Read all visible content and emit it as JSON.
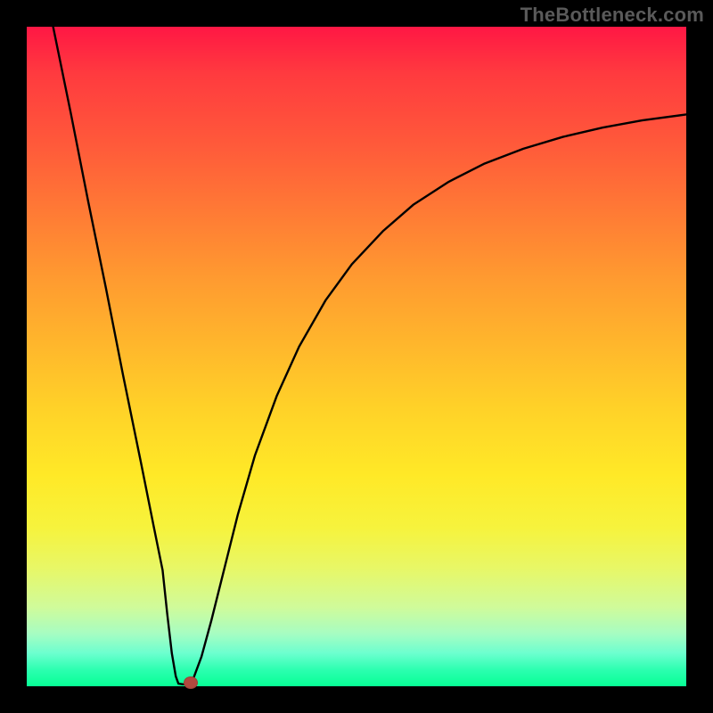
{
  "attribution": "TheBottleneck.com",
  "chart_data": {
    "type": "line",
    "title": "",
    "xlabel": "",
    "ylabel": "",
    "xlim": [
      0,
      100
    ],
    "ylim": [
      0,
      100
    ],
    "grid": false,
    "legend": false,
    "background": "rainbow-gradient-red-to-green-vertical",
    "curve_points": [
      {
        "x": 4.0,
        "y": 100.0
      },
      {
        "x": 6.7,
        "y": 86.8
      },
      {
        "x": 9.3,
        "y": 73.6
      },
      {
        "x": 12.0,
        "y": 60.4
      },
      {
        "x": 14.6,
        "y": 47.2
      },
      {
        "x": 17.3,
        "y": 34.0
      },
      {
        "x": 19.3,
        "y": 24.0
      },
      {
        "x": 20.6,
        "y": 17.6
      },
      {
        "x": 21.3,
        "y": 11.0
      },
      {
        "x": 22.0,
        "y": 5.0
      },
      {
        "x": 22.6,
        "y": 1.5
      },
      {
        "x": 23.0,
        "y": 0.4
      },
      {
        "x": 23.7,
        "y": 0.3
      },
      {
        "x": 24.3,
        "y": 0.3
      },
      {
        "x": 25.2,
        "y": 1.0
      },
      {
        "x": 26.5,
        "y": 4.5
      },
      {
        "x": 28.0,
        "y": 10.0
      },
      {
        "x": 30.0,
        "y": 18.0
      },
      {
        "x": 32.0,
        "y": 26.0
      },
      {
        "x": 34.6,
        "y": 35.0
      },
      {
        "x": 37.9,
        "y": 44.0
      },
      {
        "x": 41.3,
        "y": 51.5
      },
      {
        "x": 45.3,
        "y": 58.5
      },
      {
        "x": 49.3,
        "y": 64.0
      },
      {
        "x": 54.0,
        "y": 69.0
      },
      {
        "x": 58.6,
        "y": 73.0
      },
      {
        "x": 64.0,
        "y": 76.5
      },
      {
        "x": 69.3,
        "y": 79.2
      },
      {
        "x": 75.3,
        "y": 81.5
      },
      {
        "x": 81.3,
        "y": 83.3
      },
      {
        "x": 87.3,
        "y": 84.7
      },
      {
        "x": 93.3,
        "y": 85.8
      },
      {
        "x": 100.0,
        "y": 86.7
      }
    ],
    "marker": {
      "x": 24.8,
      "y": 0.5,
      "color": "#b3493f"
    }
  }
}
